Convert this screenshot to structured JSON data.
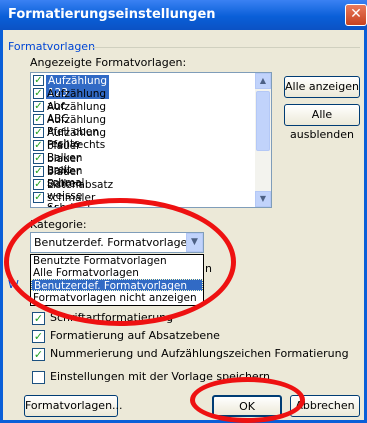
{
  "window": {
    "title": "Formatierungseinstellungen",
    "close_icon": "close-icon"
  },
  "group": {
    "heading": "Formatvorlagen",
    "shown_label": "Angezeigte Formatvorlagen:"
  },
  "styles_list": [
    {
      "label": "Aufzählung 123",
      "checked": true,
      "selected": true
    },
    {
      "label": "Aufzählung abc",
      "checked": true
    },
    {
      "label": "Aufzählung ABC",
      "checked": true
    },
    {
      "label": "Aufzählung Pfeil oben rechts",
      "checked": true
    },
    {
      "label": "Aufzählung Pfeil rechts",
      "checked": true
    },
    {
      "label": "blauer Balken breit",
      "checked": true
    },
    {
      "label": "blauer Balken schmal",
      "checked": true
    },
    {
      "label": "blauer Balken weisse Schrift",
      "checked": true
    },
    {
      "label": "Listenabsatz",
      "checked": true
    },
    {
      "label": "schmaler Abstand",
      "checked": true
    }
  ],
  "buttons": {
    "show_all": "Alle anzeigen",
    "hide_all": "Alle ausblenden",
    "styles": "Formatvorlagen...",
    "ok": "OK",
    "cancel": "Abbrechen"
  },
  "category": {
    "label": "Kategorie:",
    "selected": "Benutzerdef. Formatvorlagen",
    "options": [
      "Benutzte Formatvorlagen",
      "Alle Formatvorlagen",
      "Benutzerdef. Formatvorlagen",
      "Formatvorlagen nicht anzeigen"
    ],
    "partial_right": "n"
  },
  "section2": {
    "heading_fragment": "W"
  },
  "options": [
    {
      "label": "Schriftartformatierung",
      "checked": true
    },
    {
      "label": "Formatierung auf Absatzebene",
      "checked": true
    },
    {
      "label": "Nummerierung und Aufzählungszeichen Formatierung",
      "checked": true
    },
    {
      "label": "Einstellungen mit der Vorlage speichern",
      "checked": false
    }
  ],
  "colors": {
    "accent": "#0a5fd8",
    "highlight": "#316ac5",
    "annotation": "#ee1111"
  }
}
